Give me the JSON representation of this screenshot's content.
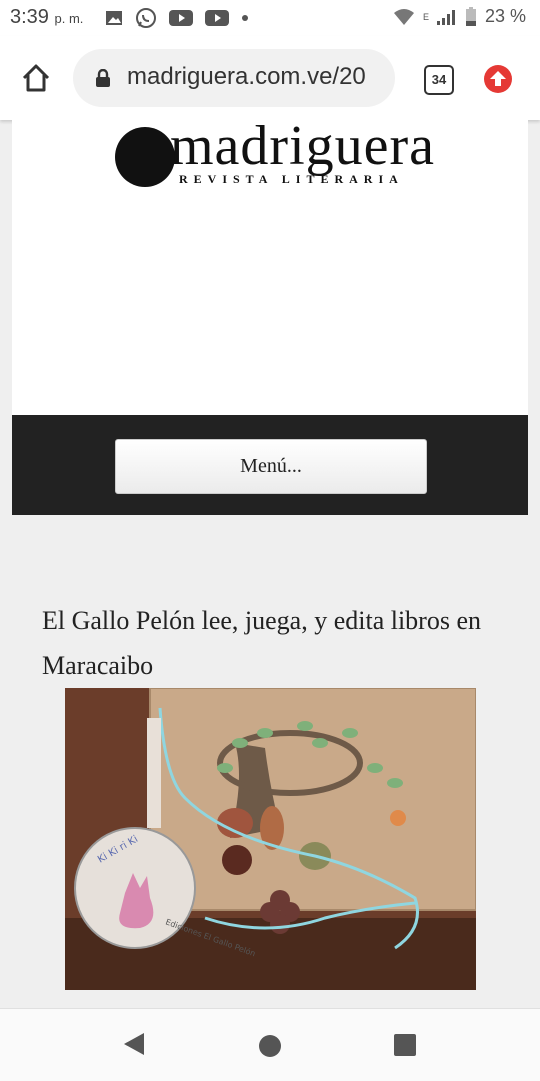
{
  "status_bar": {
    "time": "3:39",
    "ampm": "p. m.",
    "network": "E",
    "battery": "23 %"
  },
  "browser": {
    "url": "madriguera.com.ve/20",
    "tab_count": "34"
  },
  "site": {
    "logo_name": "madriguera",
    "logo_subtitle": "REVISTA LITERARIA",
    "menu_label": "Menú..."
  },
  "article": {
    "title": "El Gallo Pelón lee, juega, y edita libros en Maracaibo",
    "image_caption_text": "Ediciones El Gallo Pelón",
    "image_chant": "Ki Ki ri Ki"
  }
}
